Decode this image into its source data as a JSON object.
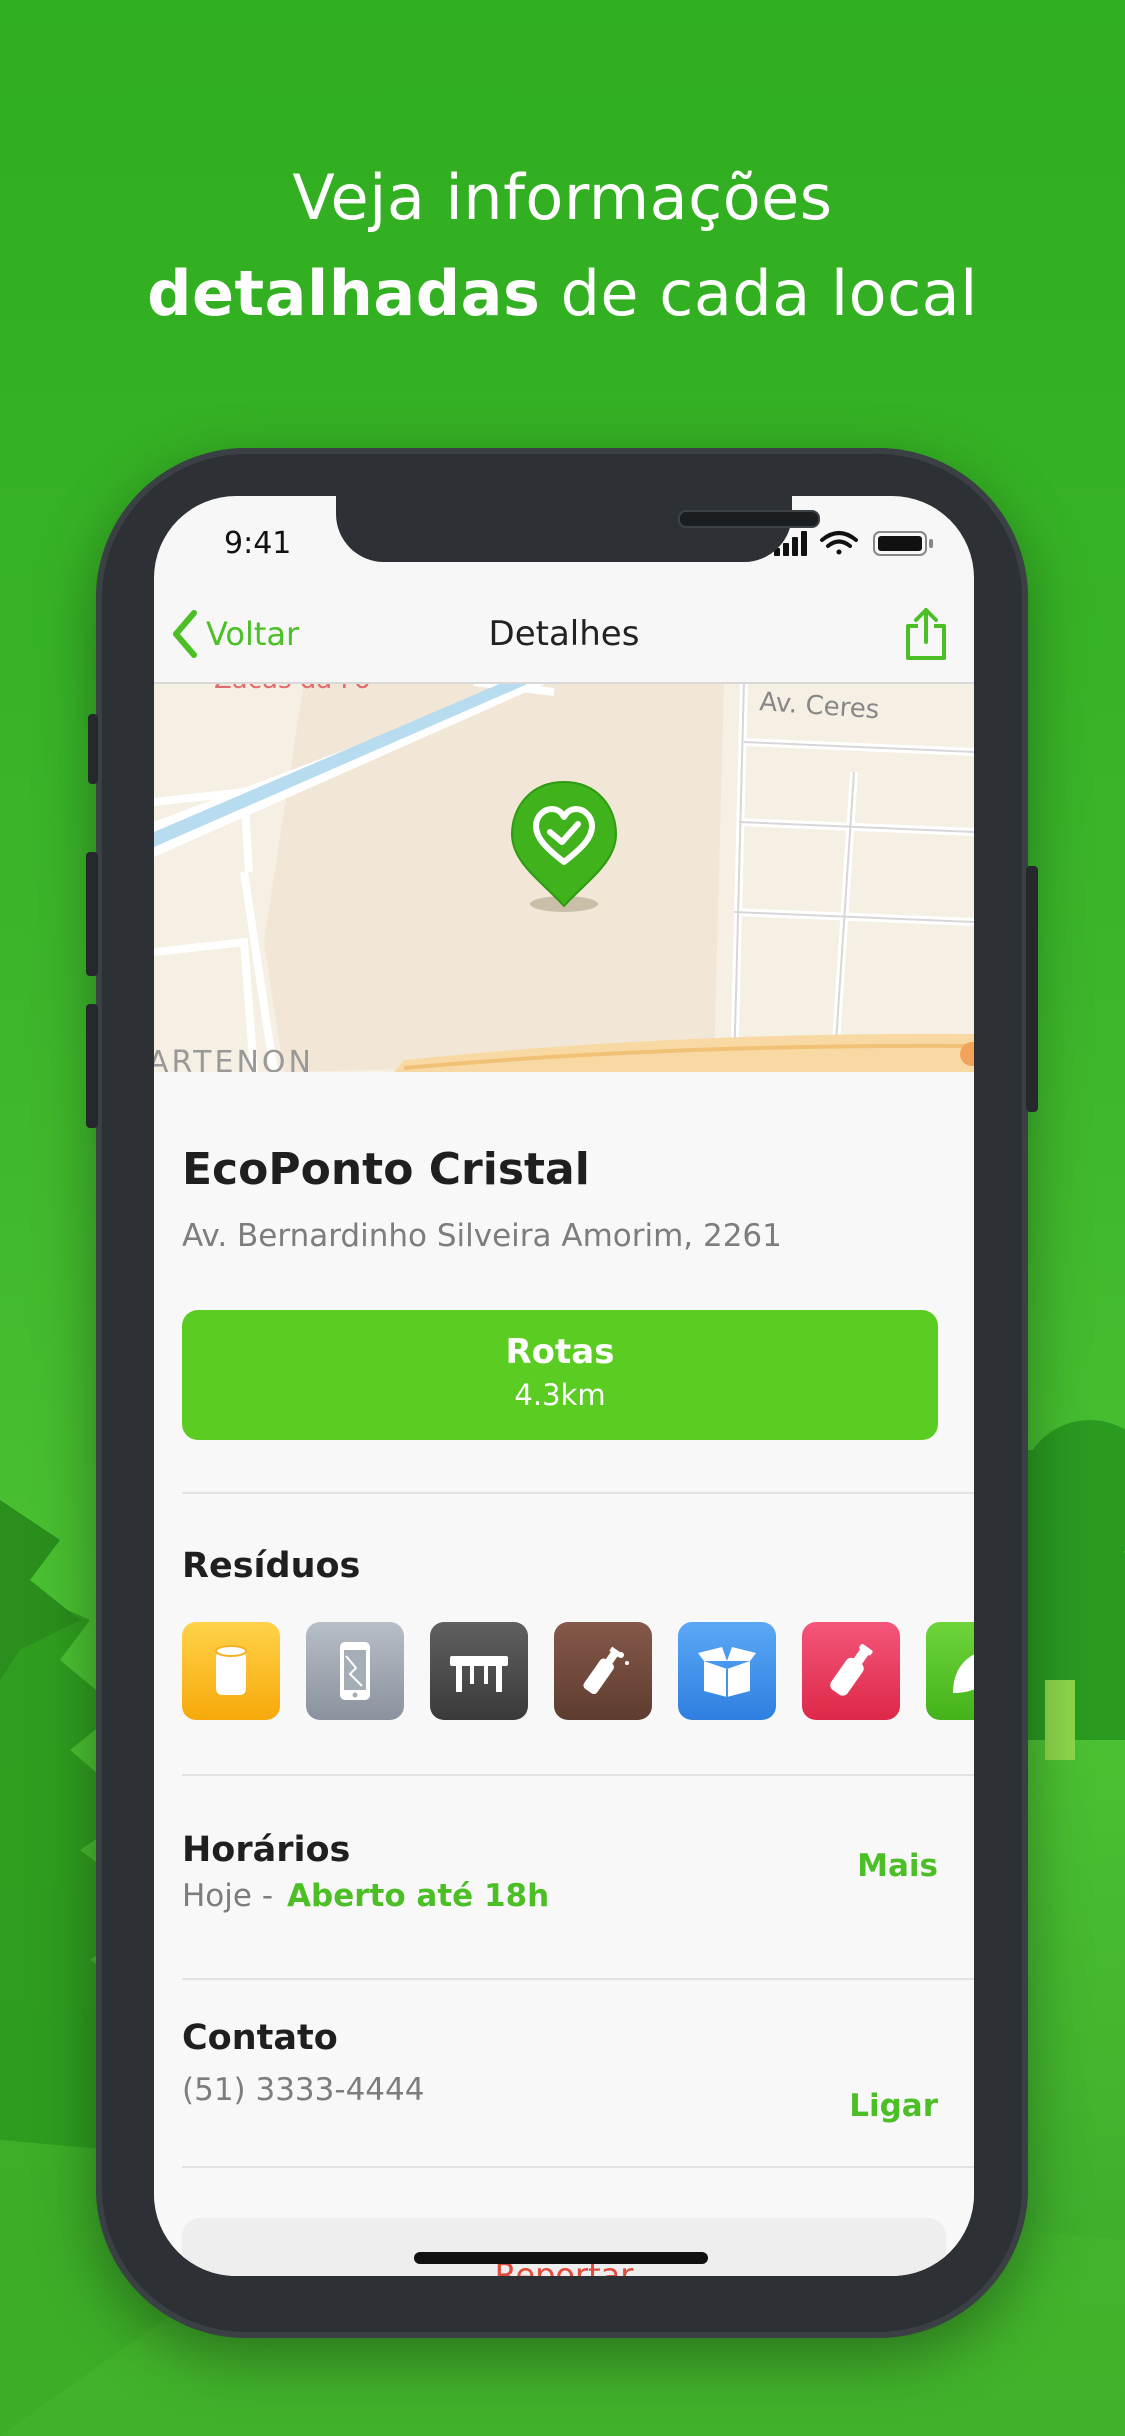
{
  "headline": {
    "line1": "Veja informações",
    "bold": "detalhadas",
    "rest": " de cada local"
  },
  "status": {
    "time": "9:41"
  },
  "nav": {
    "back_label": "Voltar",
    "title": "Detalhes"
  },
  "map": {
    "street1": "Av. Ceres",
    "street2": "ARTENON",
    "street3": "Zacas da Fo"
  },
  "place": {
    "name": "EcoPonto Cristal",
    "address": "Av. Bernardinho Silveira Amorim, 2261",
    "route_label": "Rotas",
    "route_distance": "4.3km"
  },
  "waste": {
    "title": "Resíduos",
    "items": [
      {
        "icon": "can-icon",
        "color": "#f8b50f"
      },
      {
        "icon": "broken-phone-icon",
        "color": "#9aa2ad"
      },
      {
        "icon": "table-icon",
        "color": "#4a4a4a"
      },
      {
        "icon": "oil-bottle-icon",
        "color": "#70483a"
      },
      {
        "icon": "box-icon",
        "color": "#3d8de8"
      },
      {
        "icon": "plastic-bottle-icon",
        "color": "#ea3b5a"
      },
      {
        "icon": "leaf-icon",
        "color": "#56c52a"
      }
    ]
  },
  "hours": {
    "title": "Horários",
    "today": "Hoje -",
    "status": "Aberto até 18h",
    "more": "Mais"
  },
  "contact": {
    "title": "Contato",
    "phone": "(51) 3333-4444",
    "call": "Ligar"
  },
  "report": {
    "label": "Reportar"
  },
  "colors": {
    "accent": "#5bcc22",
    "link": "#4cbf27"
  }
}
